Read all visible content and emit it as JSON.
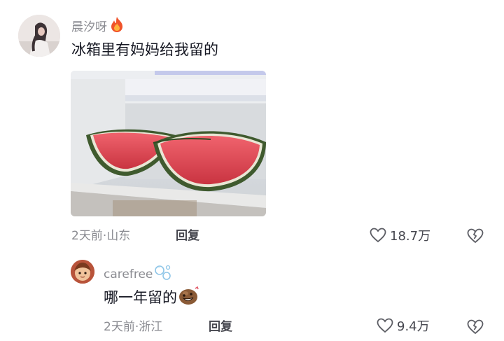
{
  "comments": [
    {
      "username": "晨汐呀",
      "username_badge": "fire-emoji",
      "text": "冰箱里有妈妈给我留的",
      "time_ago": "2天前",
      "separator": "·",
      "location": "山东",
      "reply_label": "回复",
      "like_count": "18.7万"
    }
  ],
  "reply": {
    "username": "carefree",
    "username_badge": "bubbles-emoji",
    "text": "哪一年留的",
    "text_emoji": "grinning-potato-emoji",
    "time_ago": "2天前",
    "separator": "·",
    "location": "浙江",
    "reply_label": "回复",
    "like_count": "9.4万"
  },
  "colors": {
    "secondary_text": "#8a8b91",
    "primary_text": "#161823",
    "action_text": "#45464e",
    "watermelon_flesh": "#e0424f",
    "watermelon_rind": "#3f5a2e"
  }
}
